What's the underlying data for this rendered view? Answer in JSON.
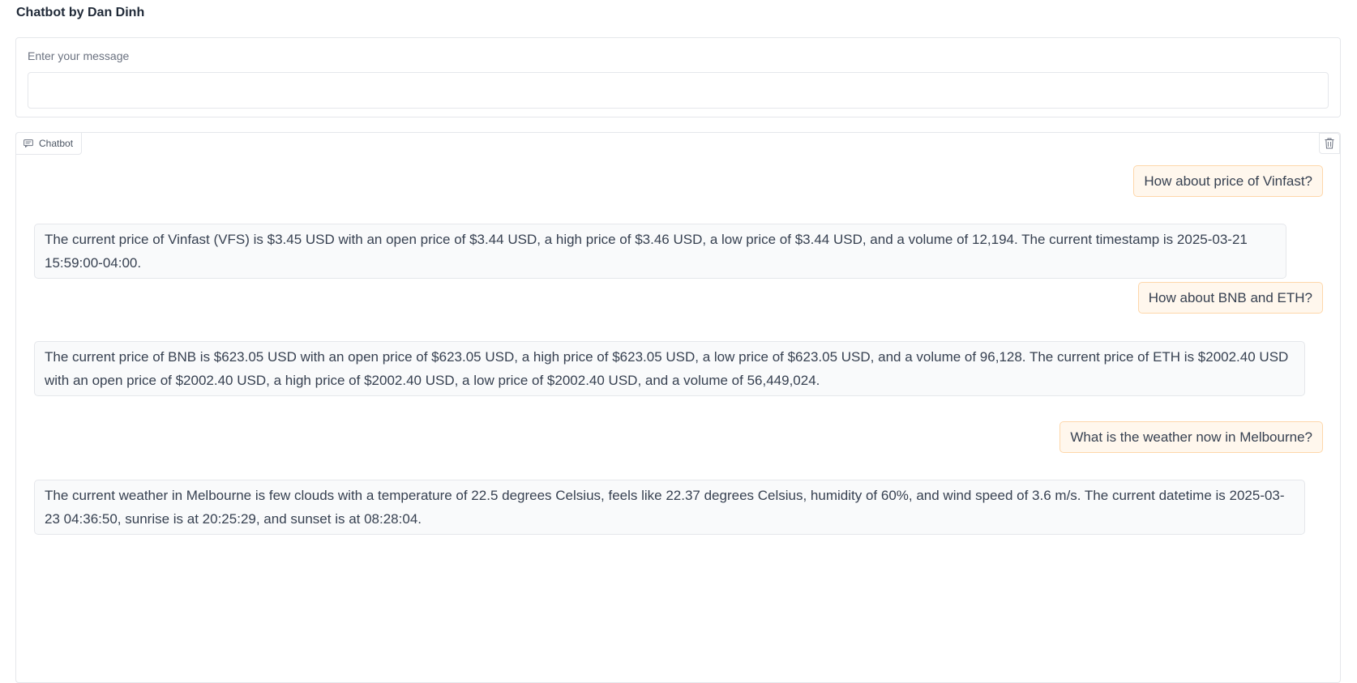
{
  "app": {
    "title": "Chatbot by Dan Dinh"
  },
  "input": {
    "label": "Enter your message",
    "value": "",
    "placeholder": ""
  },
  "chat": {
    "label": "Chatbot",
    "icons": {
      "badge": "chat-bubble-icon",
      "clear": "trash-icon"
    },
    "messages": [
      {
        "role": "user",
        "text": "How about price of Vinfast?"
      },
      {
        "role": "bot",
        "text": "The current price of Vinfast (VFS) is $3.45 USD with an open price of $3.44 USD, a high price of $3.46 USD, a low price of $3.44 USD, and a volume of 12,194. The current timestamp is 2025-03-21 15:59:00-04:00."
      },
      {
        "role": "user",
        "text": "How about BNB and ETH?"
      },
      {
        "role": "bot",
        "text": "The current price of BNB is $623.05 USD with an open price of $623.05 USD, a high price of $623.05 USD, a low price of $623.05 USD, and a volume of 96,128. The current price of ETH is $2002.40 USD with an open price of $2002.40 USD, a high price of $2002.40 USD, a low price of $2002.40 USD, and a volume of 56,449,024."
      },
      {
        "role": "user",
        "text": "What is the weather now in Melbourne?"
      },
      {
        "role": "bot",
        "text": "The current weather in Melbourne is few clouds with a temperature of 22.5 degrees Celsius, feels like 22.37 degrees Celsius, humidity of 60%, and wind speed of 3.6 m/s. The current datetime is 2025-03-23 04:36:50, sunrise is at 20:25:29, and sunset is at 08:28:04."
      }
    ]
  },
  "colors": {
    "user_bubble_bg": "#fff7ed",
    "user_bubble_border": "#fed7aa",
    "bot_bubble_bg": "#f9fafb",
    "border": "#e5e7eb"
  }
}
